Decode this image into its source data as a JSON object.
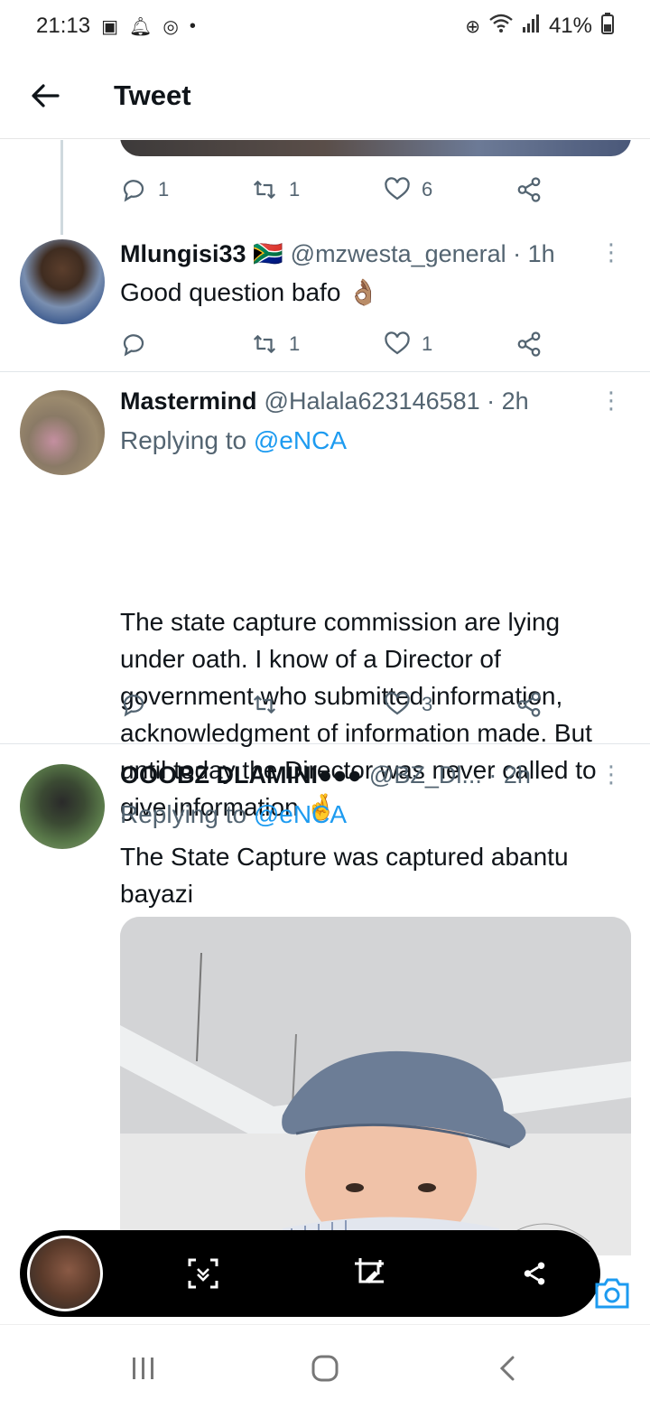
{
  "status_bar": {
    "time": "21:13",
    "battery": "41%",
    "dot": "•"
  },
  "header": {
    "title": "Tweet"
  },
  "top_actions": {
    "reply_count": "1",
    "retweet_count": "1",
    "like_count": "6"
  },
  "tweets": [
    {
      "name": "Mlungisi33 🇿🇦",
      "handle": "@mzwesta_general · 1h",
      "text": "Good question bafo 👌🏽",
      "reply_count": "",
      "retweet_count": "1",
      "like_count": "1"
    },
    {
      "name": "Mastermind",
      "handle": "@Halala623146581 · 2h",
      "replying_prefix": "Replying to ",
      "replying_to": "@eNCA",
      "text": "The state capture commission are lying under oath. I know of a Director of government who submitted information, acknowledgment of information made. But until today the Director was never called to give information 🤞",
      "reply_count": "",
      "retweet_count": "",
      "like_count": "3"
    },
    {
      "name": "OOOBZ DLAMINI●●●",
      "handle": "@BZ_Dl... · 2h",
      "replying_prefix": "Replying to ",
      "replying_to": "@eNCA",
      "text": "The State Capture was captured abantu bayazi"
    }
  ],
  "icons": [
    "back-arrow-icon",
    "reply-icon",
    "retweet-icon",
    "like-icon",
    "share-icon",
    "more-icon",
    "scan-icon",
    "crop-edit-icon",
    "camera-icon",
    "recents-icon",
    "home-icon",
    "back-icon"
  ]
}
